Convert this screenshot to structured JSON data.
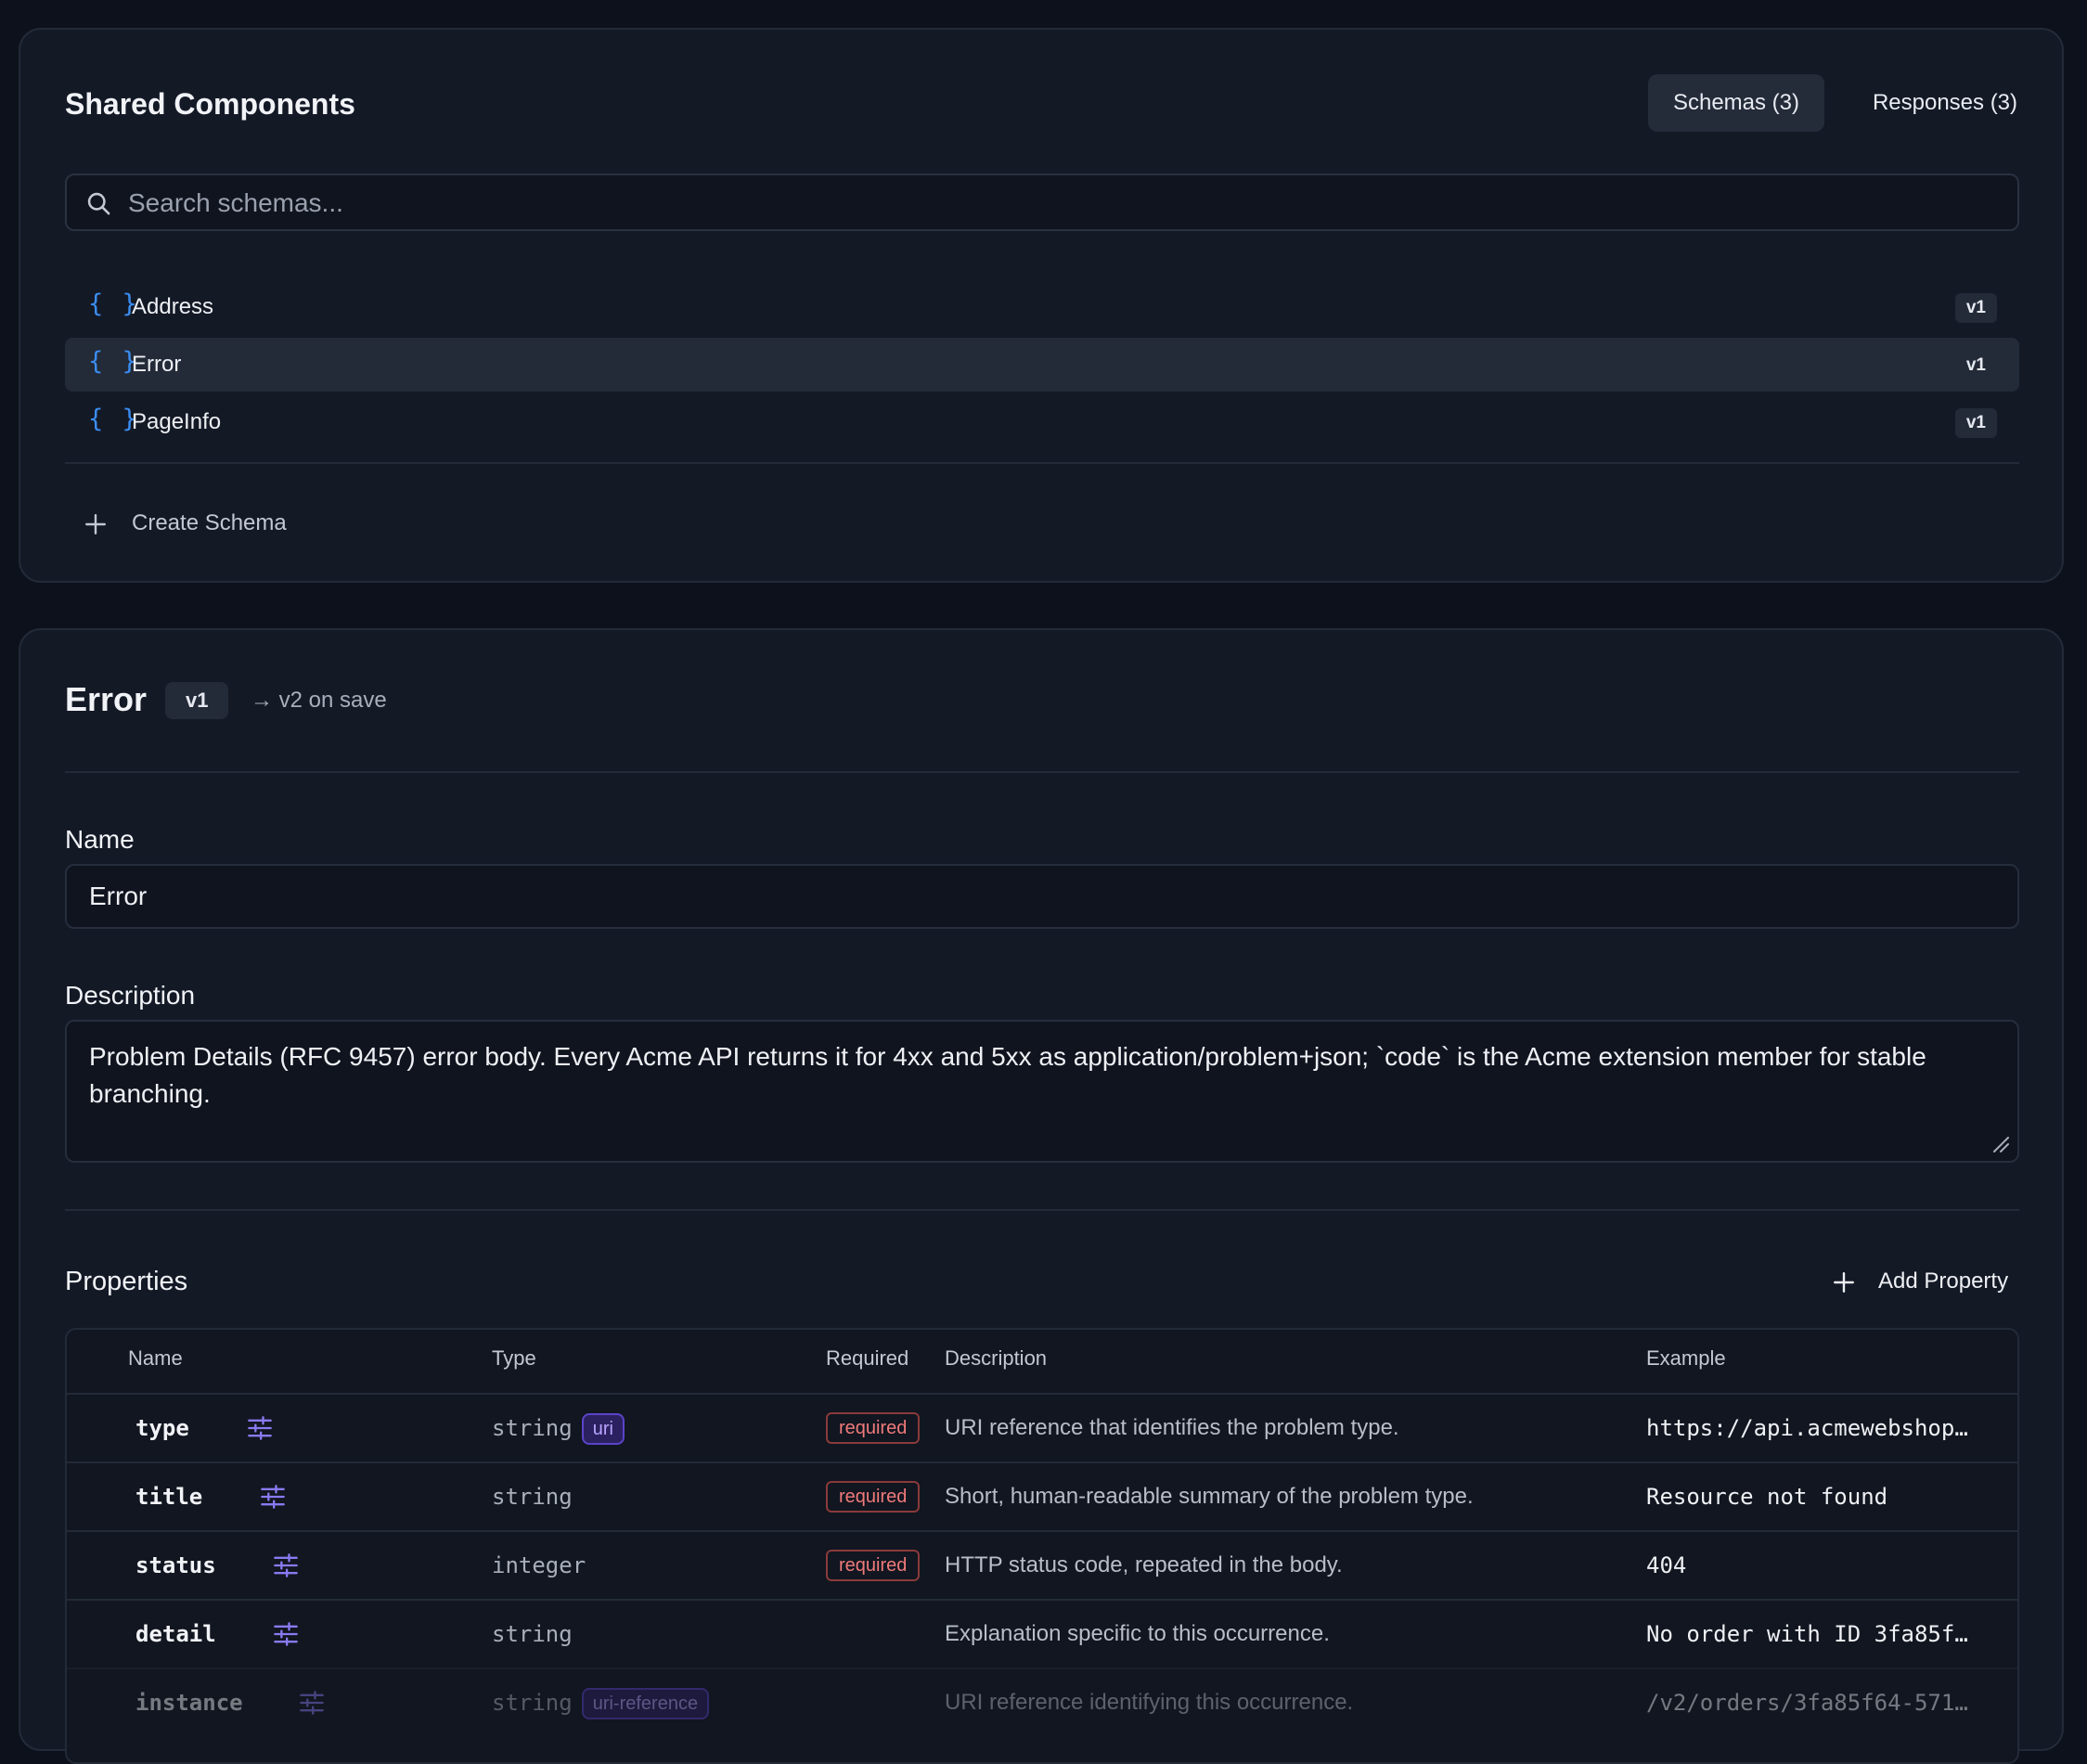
{
  "components": {
    "title": "Shared Components",
    "tabs": [
      {
        "label": "Schemas (3)",
        "active": true
      },
      {
        "label": "Responses (3)",
        "active": false
      }
    ],
    "search": {
      "placeholder": "Search schemas...",
      "value": ""
    },
    "schemas": [
      {
        "name": "Address",
        "version": "v1",
        "selected": false
      },
      {
        "name": "Error",
        "version": "v1",
        "selected": true
      },
      {
        "name": "PageInfo",
        "version": "v1",
        "selected": false
      }
    ],
    "create_label": "Create Schema"
  },
  "editor": {
    "title": "Error",
    "version": "v1",
    "next_version_note": "→ v2 on save",
    "name_label": "Name",
    "name_value": "Error",
    "description_label": "Description",
    "description_value": "Problem Details (RFC 9457) error body. Every Acme API returns it for 4xx and 5xx as application/problem+json; `code` is the Acme extension member for stable branching.",
    "properties_title": "Properties",
    "add_property_label": "Add Property",
    "columns": [
      "Name",
      "Type",
      "Required",
      "Description",
      "Example"
    ],
    "properties": [
      {
        "name": "type",
        "type": "string",
        "format": "uri",
        "required": "required",
        "description": "URI reference that identifies the problem type.",
        "example": "https://api.acmewebshop.…"
      },
      {
        "name": "title",
        "type": "string",
        "format": "",
        "required": "required",
        "description": "Short, human-readable summary of the problem type.",
        "example": "Resource not found"
      },
      {
        "name": "status",
        "type": "integer",
        "format": "",
        "required": "required",
        "description": "HTTP status code, repeated in the body.",
        "example": "404"
      },
      {
        "name": "detail",
        "type": "string",
        "format": "",
        "required": "",
        "description": "Explanation specific to this occurrence.",
        "example": "No order with ID 3fa85f6…"
      },
      {
        "name": "instance",
        "type": "string",
        "format": "uri-reference",
        "required": "",
        "description": "URI reference identifying this occurrence.",
        "example": "/v2/orders/3fa85f64-5717…"
      }
    ]
  },
  "colors": {
    "background": "#0d111b",
    "panel": "#141926",
    "accent_blue": "#3b8df0",
    "format_badge": "#b7a4ff",
    "required_badge": "#f07a7a"
  },
  "icons": {
    "search": "search-icon",
    "schema": "braces-icon",
    "add": "plus-icon",
    "property_settings": "sliders-icon"
  }
}
